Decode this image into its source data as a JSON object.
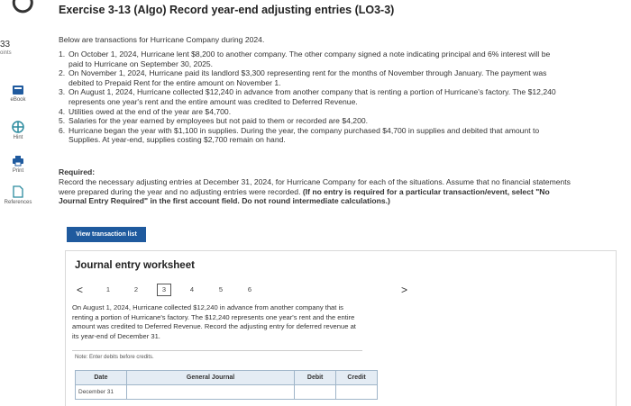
{
  "title": "Exercise 3-13 (Algo) Record year-end adjusting entries (LO3-3)",
  "sidebar": {
    "points_value": "33",
    "points_label": "oints",
    "items": [
      {
        "label": "eBook",
        "icon": "book-icon"
      },
      {
        "label": "Hint",
        "icon": "hint-icon"
      },
      {
        "label": "Print",
        "icon": "printer-icon"
      },
      {
        "label": "References",
        "icon": "document-icon"
      }
    ]
  },
  "intro": "Below are transactions for Hurricane Company during 2024.",
  "transactions": [
    {
      "num": "1.",
      "text": "On October 1, 2024, Hurricane lent $8,200 to another company. The other company signed a note indicating principal and 6% interest will be paid to Hurricane on September 30, 2025."
    },
    {
      "num": "2.",
      "text": "On November 1, 2024, Hurricane paid its landlord $3,300 representing rent for the months of November through January. The payment was debited to Prepaid Rent for the entire amount on November 1."
    },
    {
      "num": "3.",
      "text": "On August 1, 2024, Hurricane collected $12,240 in advance from another company that is renting a portion of Hurricane's factory. The $12,240 represents one year's rent and the entire amount was credited to Deferred Revenue."
    },
    {
      "num": "4.",
      "text": "Utilities owed at the end of the year are $4,700."
    },
    {
      "num": "5.",
      "text": "Salaries for the year earned by employees but not paid to them or recorded are $4,200."
    },
    {
      "num": "6.",
      "text": "Hurricane began the year with $1,100 in supplies. During the year, the company purchased $4,700 in supplies and debited that amount to Supplies. At year-end, supplies costing $2,700 remain on hand."
    }
  ],
  "required": {
    "heading": "Required:",
    "text": "Record the necessary adjusting entries at December 31, 2024, for Hurricane Company for each of the situations. Assume that no financial statements were prepared during the year and no adjusting entries were recorded. ",
    "bold_text": "(If no entry is required for a particular transaction/event, select \"No Journal Entry Required\" in the first account field. Do not round intermediate calculations.)"
  },
  "view_button_label": "View transaction list",
  "worksheet": {
    "title": "Journal entry worksheet",
    "prev_arrow": "<",
    "next_arrow": ">",
    "pages": [
      "1",
      "2",
      "3",
      "4",
      "5",
      "6"
    ],
    "active_page": "3",
    "description": "On August 1, 2024, Hurricane collected $12,240 in advance from another company that is renting a portion of Hurricane's factory. The $12,240 represents one year's rent and the entire amount was credited to Deferred Revenue. Record the adjusting entry for deferred revenue at its year-end of December 31.",
    "note": "Note: Enter debits before credits.",
    "columns": [
      "Date",
      "General Journal",
      "Debit",
      "Credit"
    ],
    "rows": [
      {
        "date": "December 31",
        "account": "",
        "debit": "",
        "credit": ""
      }
    ]
  },
  "colors": {
    "button": "#1f5a9e",
    "table_header": "#e4ecf4",
    "icon_blue": "#1f5a9e",
    "icon_teal": "#2a8a9e"
  }
}
